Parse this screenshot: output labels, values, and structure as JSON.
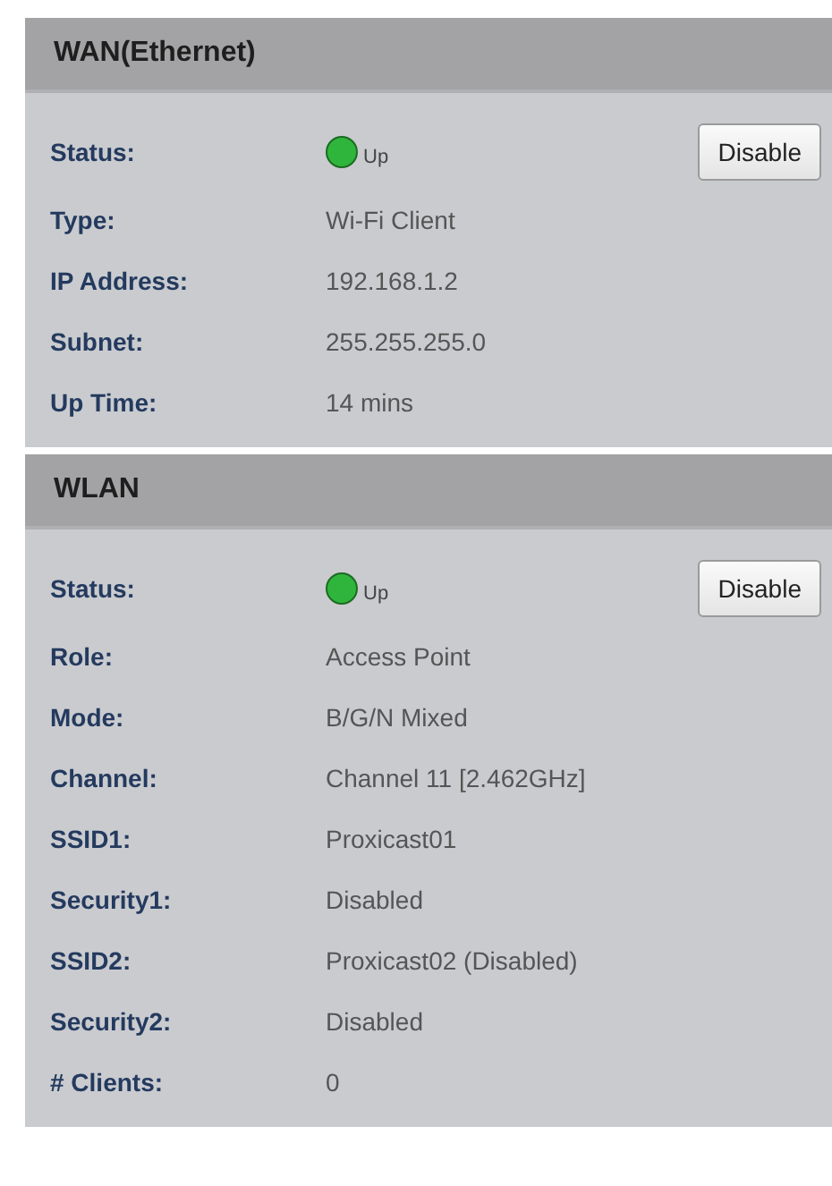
{
  "sections": [
    {
      "title": "WAN(Ethernet)",
      "rows": [
        {
          "kind": "status",
          "label": "Status:",
          "value": "Up",
          "color": "#2fb53c",
          "button": "Disable"
        },
        {
          "kind": "text",
          "label": "Type:",
          "value": "Wi-Fi Client"
        },
        {
          "kind": "text",
          "label": "IP Address:",
          "value": "192.168.1.2"
        },
        {
          "kind": "text",
          "label": "Subnet:",
          "value": "255.255.255.0"
        },
        {
          "kind": "text",
          "label": "Up Time:",
          "value": "14 mins"
        }
      ]
    },
    {
      "title": "WLAN",
      "rows": [
        {
          "kind": "status",
          "label": "Status:",
          "value": "Up",
          "color": "#2fb53c",
          "button": "Disable"
        },
        {
          "kind": "text",
          "label": "Role:",
          "value": "Access Point"
        },
        {
          "kind": "text",
          "label": "Mode:",
          "value": "B/G/N Mixed"
        },
        {
          "kind": "text",
          "label": "Channel:",
          "value": "Channel 11 [2.462GHz]"
        },
        {
          "kind": "text",
          "label": "SSID1:",
          "value": "Proxicast01"
        },
        {
          "kind": "text",
          "label": "Security1:",
          "value": "Disabled"
        },
        {
          "kind": "text",
          "label": "SSID2:",
          "value": "Proxicast02 (Disabled)"
        },
        {
          "kind": "text",
          "label": "Security2:",
          "value": "Disabled"
        },
        {
          "kind": "text",
          "label": "# Clients:",
          "value": "0"
        }
      ]
    }
  ]
}
